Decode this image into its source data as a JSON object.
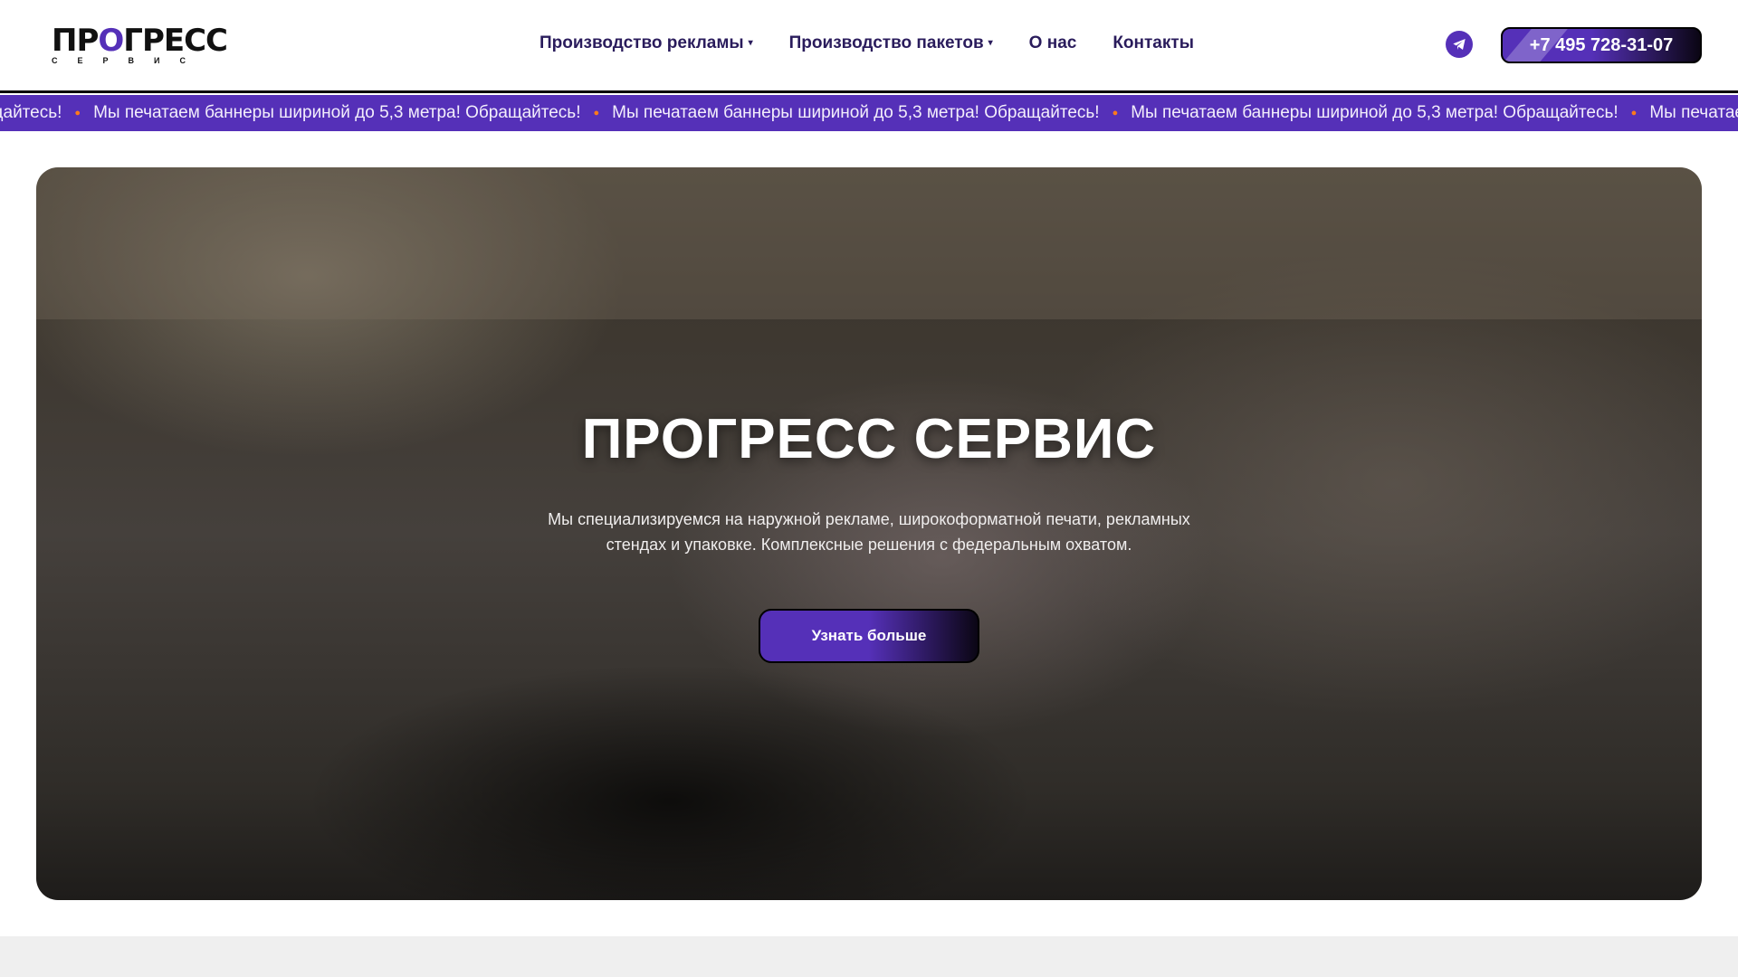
{
  "header": {
    "logo_text": "ПРОГРЕСС",
    "logo_sub": "СЕРВИС",
    "nav": [
      {
        "label": "Производство рекламы",
        "dropdown": true
      },
      {
        "label": "Производство пакетов",
        "dropdown": true
      },
      {
        "label": "О нас",
        "dropdown": false
      },
      {
        "label": "Контакты",
        "dropdown": false
      }
    ],
    "telegram_icon": "telegram-icon",
    "phone": "+7 495 728-31-07"
  },
  "marquee": {
    "text": "Мы печатаем баннеры шириной до 5,3 метра! Обращайтесь!",
    "separator_icon": "fire-icon"
  },
  "hero": {
    "title": "ПРОГРЕСС СЕРВИС",
    "subtitle": "Мы специализируемся на наружной рекламе, широкоформатной печати, рекламных стендах и упаковке. Комплексные решения с федеральным охватом.",
    "cta": "Узнать больше"
  },
  "colors": {
    "accent": "#5530b8",
    "dark": "#0b0614"
  }
}
